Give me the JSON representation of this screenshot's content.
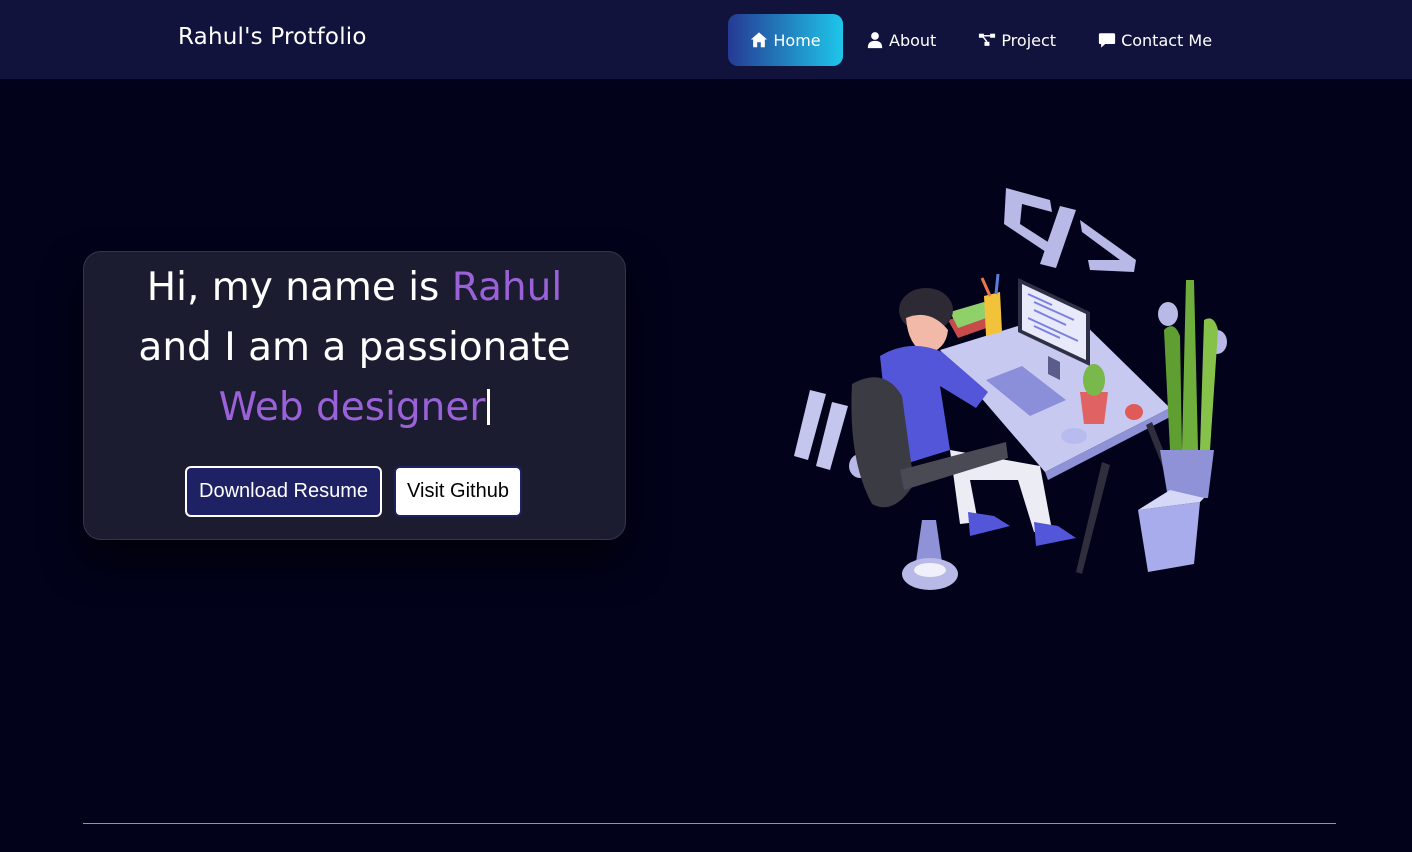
{
  "navbar": {
    "brand": "Rahul's Protfolio",
    "items": [
      {
        "label": "Home",
        "icon": "home-icon",
        "active": true
      },
      {
        "label": "About",
        "icon": "user-icon",
        "active": false
      },
      {
        "label": "Project",
        "icon": "project-icon",
        "active": false
      },
      {
        "label": "Contact Me",
        "icon": "chat-icon",
        "active": false
      }
    ]
  },
  "hero": {
    "line1": "Hi, my name is ",
    "name": "Rahul",
    "line2": "and I am a passionate",
    "role": "Web designer",
    "buttons": {
      "primary": "Download Resume",
      "secondary": "Visit Github"
    }
  },
  "colors": {
    "background": "#02021a",
    "navbar": "#12133d",
    "accent": "#9a61d9",
    "active_gradient_start": "#253a93",
    "active_gradient_end": "#1ec6ea",
    "button_primary": "#1e2163"
  }
}
